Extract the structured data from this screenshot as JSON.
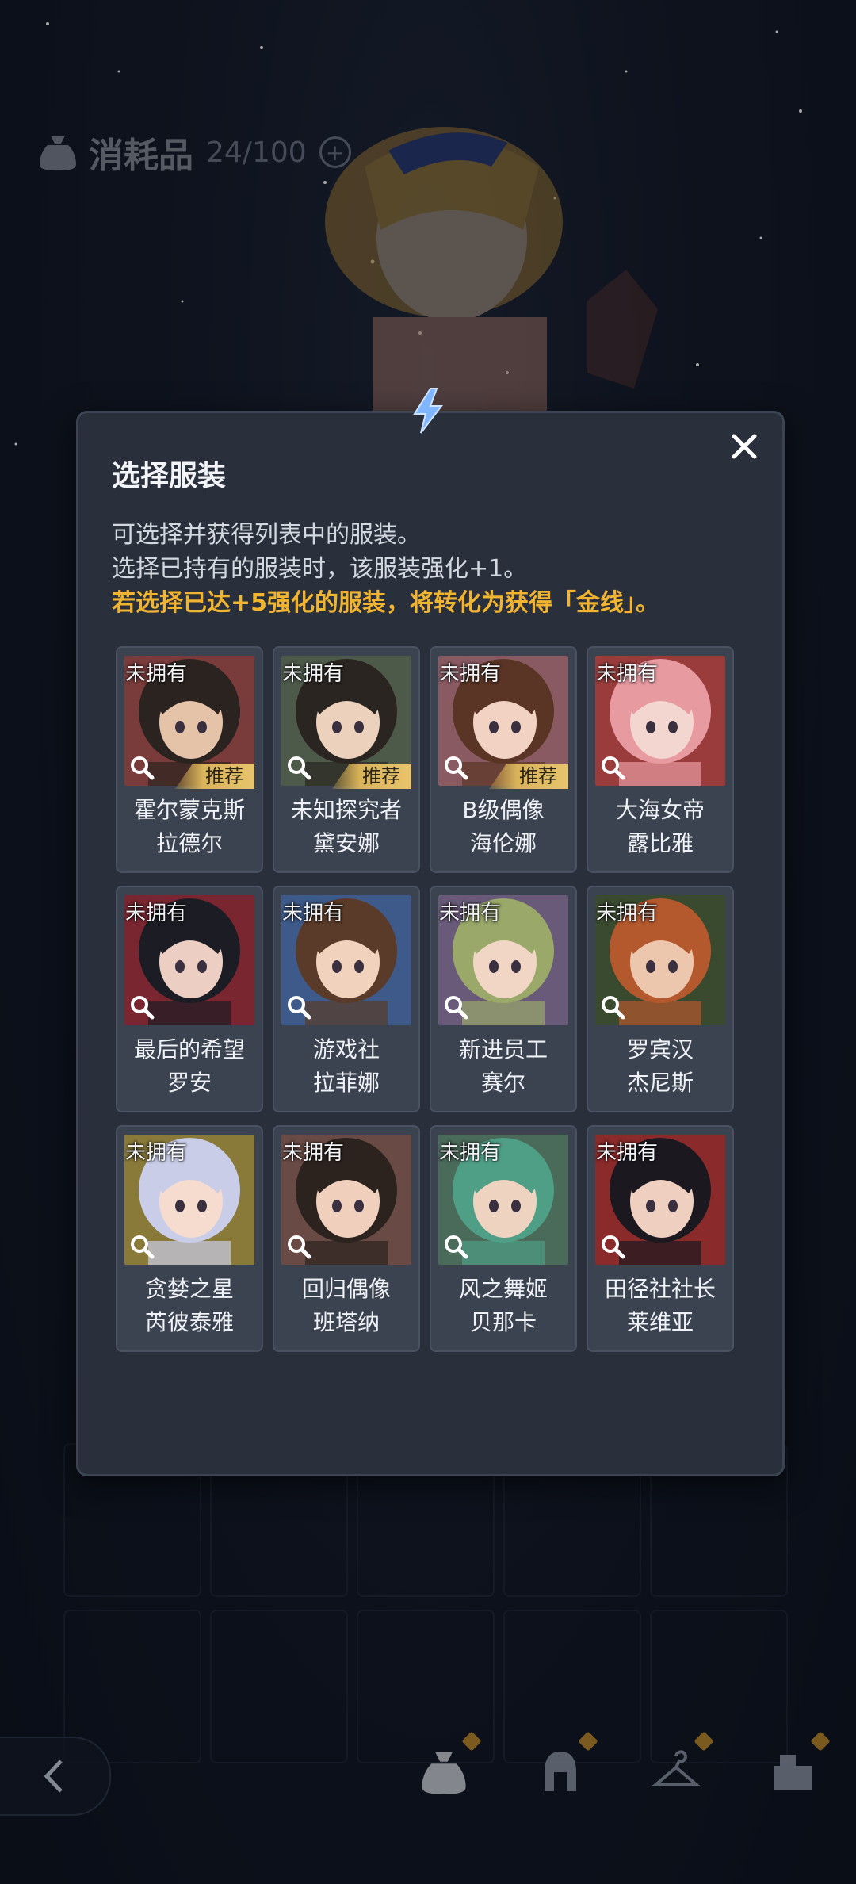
{
  "background": {
    "inventory_title": "消耗品",
    "inventory_count": "24/100"
  },
  "modal": {
    "title": "选择服装",
    "desc_line1": "可选择并获得列表中的服装。",
    "desc_line2": "选择已持有的服装时，该服装强化+1。",
    "desc_line3": "若选择已达+5强化的服装，将转化为获得「金线」。",
    "unowned_label": "未拥有",
    "recommend_label": "推荐"
  },
  "costumes": [
    {
      "line1": "霍尔蒙克斯",
      "line2": "拉德尔",
      "recommended": true,
      "bg": "#7a3b3b",
      "hair": "#2b2320",
      "skin": "#e5c3a8"
    },
    {
      "line1": "未知探究者",
      "line2": "黛安娜",
      "recommended": true,
      "bg": "#4d5a4a",
      "hair": "#2a2520",
      "skin": "#ecd1bd"
    },
    {
      "line1": "B级偶像",
      "line2": "海伦娜",
      "recommended": true,
      "bg": "#8a5a62",
      "hair": "#5a3424",
      "skin": "#f2d3c3"
    },
    {
      "line1": "大海女帝",
      "line2": "露比雅",
      "recommended": false,
      "bg": "#9a3c3c",
      "hair": "#e79aa0",
      "skin": "#f3d6cf"
    },
    {
      "line1": "最后的希望",
      "line2": "罗安",
      "recommended": false,
      "bg": "#7a2630",
      "hair": "#1c1c24",
      "skin": "#eccfc2"
    },
    {
      "line1": "游戏社",
      "line2": "拉菲娜",
      "recommended": false,
      "bg": "#3d5a8a",
      "hair": "#5a3a28",
      "skin": "#f0d2bd"
    },
    {
      "line1": "新进员工",
      "line2": "赛尔",
      "recommended": false,
      "bg": "#6a5a7a",
      "hair": "#9aa86a",
      "skin": "#f1d6c6"
    },
    {
      "line1": "罗宾汉",
      "line2": "杰尼斯",
      "recommended": false,
      "bg": "#3a4a2e",
      "hair": "#b4592e",
      "skin": "#ecc7ae"
    },
    {
      "line1": "贪婪之星",
      "line2": "芮彼泰雅",
      "recommended": false,
      "bg": "#8a7a3a",
      "hair": "#c9cde8",
      "skin": "#f5dccf"
    },
    {
      "line1": "回归偶像",
      "line2": "班塔纳",
      "recommended": false,
      "bg": "#6a4a44",
      "hair": "#2c221e",
      "skin": "#f0d0bd"
    },
    {
      "line1": "风之舞姬",
      "line2": "贝那卡",
      "recommended": false,
      "bg": "#4a6a5a",
      "hair": "#4f9e86",
      "skin": "#eed3c0"
    },
    {
      "line1": "田径社社长",
      "line2": "莱维亚",
      "recommended": false,
      "bg": "#8a2a2a",
      "hair": "#1b1820",
      "skin": "#efcfbf"
    }
  ]
}
